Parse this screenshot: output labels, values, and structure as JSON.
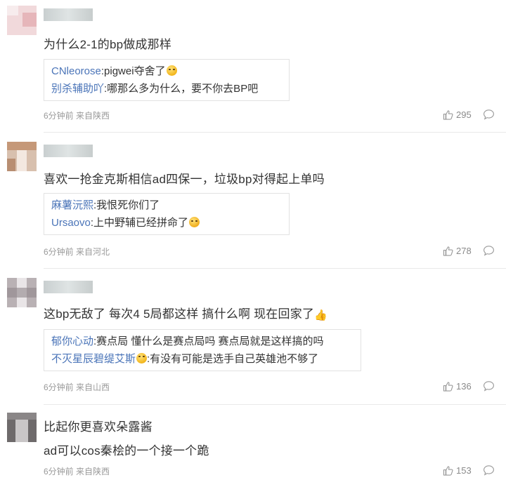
{
  "comments": [
    {
      "text": "为什么2-1的bp做成那样",
      "replies": [
        {
          "name": "CNleorose",
          "text": ":pigwei夺舍了",
          "emoji": "laugh-emoji"
        },
        {
          "name": "别杀辅助吖",
          "text": ":哪那么多为什么，要不你去BP吧",
          "emoji": ""
        }
      ],
      "meta": "6分钟前 来自陕西",
      "likes": "295"
    },
    {
      "text": "喜欢一抢金克斯相信ad四保一，垃圾bp对得起上单吗",
      "replies": [
        {
          "name": "麻薯沅熙",
          "text": ":我恨死你们了",
          "emoji": ""
        },
        {
          "name": "Ursaovo",
          "text": ":上中野辅已经拼命了",
          "emoji": "cry-emoji"
        }
      ],
      "meta": "6分钟前 来自河北",
      "likes": "278"
    },
    {
      "text": "这bp无敌了 每次4 5局都这样 搞什么啊 现在回家了",
      "text_emoji": "thumbs-up-emoji",
      "replies": [
        {
          "name": "郁你心动",
          "text": ":赛点局 懂什么是赛点局吗 赛点局就是这样搞的吗",
          "emoji": ""
        },
        {
          "name": "不灭星辰碧缇艾斯",
          "text": ":有没有可能是选手自己英雄池不够了",
          "emoji": "smile-emoji",
          "emoji_before": true
        }
      ],
      "meta": "6分钟前 来自山西",
      "likes": "136"
    },
    {
      "text": "比起你更喜欢朵露酱",
      "text2": "ad可以cos秦桧的一个接一个跪",
      "meta": "6分钟前 来自陕西",
      "likes": "153"
    }
  ],
  "icons": {
    "like": "thumbs-up-icon",
    "reply": "comment-bubble-icon"
  },
  "colors": {
    "username_link": "#4a74b8",
    "meta_text": "#9a9a9a",
    "divider": "#e9e9e9"
  }
}
